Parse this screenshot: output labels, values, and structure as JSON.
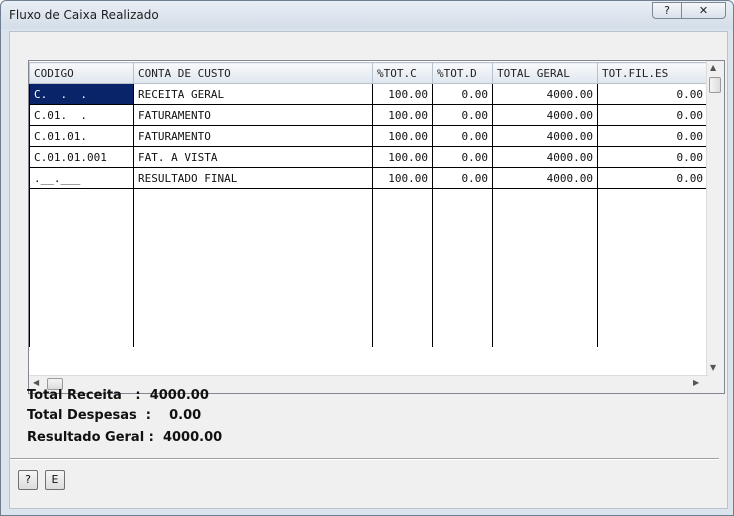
{
  "window": {
    "title": "Fluxo de Caixa Realizado",
    "help_glyph": "?",
    "close_glyph": "✕"
  },
  "grid": {
    "columns": [
      "CODIGO",
      "CONTA DE CUSTO",
      "%TOT.C",
      "%TOT.D",
      "TOTAL GERAL",
      "TOT.FIL.ES"
    ],
    "rows": [
      [
        "C.  .  .",
        "RECEITA GERAL",
        "100.00",
        "0.00",
        "4000.00",
        "0.00"
      ],
      [
        "C.01.  .",
        "FATURAMENTO",
        "100.00",
        "0.00",
        "4000.00",
        "0.00"
      ],
      [
        "C.01.01.",
        "FATURAMENTO",
        "100.00",
        "0.00",
        "4000.00",
        "0.00"
      ],
      [
        "C.01.01.001",
        "FAT. A VISTA",
        "100.00",
        "0.00",
        "4000.00",
        "0.00"
      ],
      [
        ".__.___",
        "RESULTADO FINAL",
        "100.00",
        "0.00",
        "4000.00",
        "0.00"
      ]
    ],
    "selected_row": 0
  },
  "summary": {
    "receita_label": "Total Receita   :",
    "receita_value": "4000.00",
    "despesas_label": "Total Despesas  :",
    "despesas_value": "0.00",
    "resultado_label": "Resultado Geral :",
    "resultado_value": "4000.00"
  },
  "buttons": {
    "help_label": "?",
    "e_label": "E"
  },
  "colors": {
    "selection": "#0a246a",
    "header": "#dfe6ee",
    "window_frame": "#dbe3ec"
  }
}
